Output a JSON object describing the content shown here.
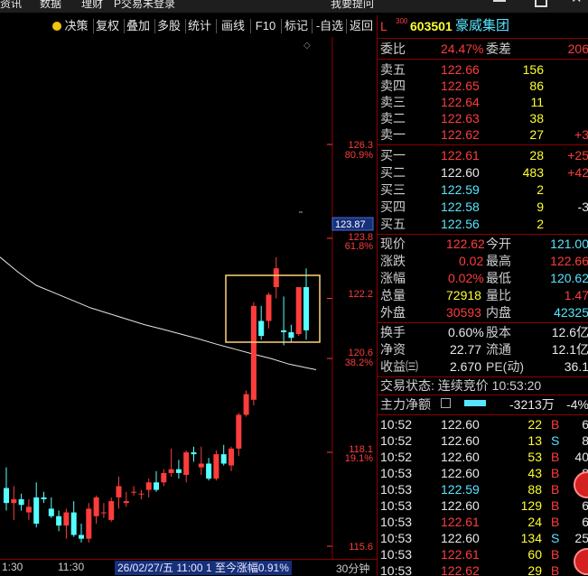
{
  "menubar": {
    "items": [
      "资讯",
      "数据",
      "理财",
      "P交易未登录"
    ],
    "right_label": "我要提问"
  },
  "toolbar": {
    "items": [
      "决策",
      "复权",
      "叠加",
      "多股",
      "统计",
      "画线",
      "F10",
      "标记",
      "-自选",
      "返回"
    ]
  },
  "chart": {
    "price_labels": [
      "126.3",
      "123.8",
      "122.2",
      "120.6",
      "118.1",
      "115.6"
    ],
    "pct_labels": [
      "80.9%",
      "61.8%",
      "38.2%",
      "19.1%"
    ],
    "current_price_tag": "123.87"
  },
  "chart_data": {
    "type": "candlestick",
    "period": "30分钟",
    "x_tick_labels": [
      "1:30",
      "11:30"
    ],
    "price_ticks": [
      126.3,
      123.8,
      122.2,
      120.6,
      118.1,
      115.6
    ],
    "fib_levels": [
      "80.9%",
      "61.8%",
      "38.2%",
      "19.1%"
    ],
    "ylim": [
      115.3,
      127.4
    ],
    "candles": [
      {
        "o": 117.15,
        "h": 117.7,
        "l": 116.55,
        "c": 116.75
      },
      {
        "o": 116.75,
        "h": 117.2,
        "l": 116.3,
        "c": 116.85
      },
      {
        "o": 116.85,
        "h": 117.0,
        "l": 116.55,
        "c": 116.7
      },
      {
        "o": 116.5,
        "h": 116.85,
        "l": 116.3,
        "c": 116.65
      },
      {
        "o": 116.9,
        "h": 117.3,
        "l": 116.1,
        "c": 116.2
      },
      {
        "o": 116.9,
        "h": 117.05,
        "l": 116.75,
        "c": 116.85
      },
      {
        "o": 116.6,
        "h": 116.9,
        "l": 116.35,
        "c": 116.4
      },
      {
        "o": 116.4,
        "h": 116.55,
        "l": 116.0,
        "c": 116.15
      },
      {
        "o": 116.15,
        "h": 116.6,
        "l": 115.8,
        "c": 116.5
      },
      {
        "o": 116.5,
        "h": 116.8,
        "l": 115.85,
        "c": 115.9
      },
      {
        "o": 115.9,
        "h": 116.2,
        "l": 115.7,
        "c": 115.8
      },
      {
        "o": 115.8,
        "h": 116.75,
        "l": 115.7,
        "c": 116.6
      },
      {
        "o": 116.4,
        "h": 116.95,
        "l": 116.2,
        "c": 116.9
      },
      {
        "o": 116.5,
        "h": 116.75,
        "l": 116.35,
        "c": 116.5
      },
      {
        "o": 116.3,
        "h": 116.9,
        "l": 116.25,
        "c": 116.8
      },
      {
        "o": 116.9,
        "h": 117.45,
        "l": 116.6,
        "c": 117.2
      },
      {
        "o": 116.75,
        "h": 117.05,
        "l": 116.65,
        "c": 116.8
      },
      {
        "o": 117.05,
        "h": 117.2,
        "l": 116.95,
        "c": 117.05
      },
      {
        "o": 117.0,
        "h": 117.1,
        "l": 116.85,
        "c": 117.0
      },
      {
        "o": 117.1,
        "h": 117.4,
        "l": 116.9,
        "c": 117.3
      },
      {
        "o": 117.3,
        "h": 117.6,
        "l": 117.05,
        "c": 117.1
      },
      {
        "o": 117.3,
        "h": 117.65,
        "l": 117.2,
        "c": 117.55
      },
      {
        "o": 117.55,
        "h": 118.2,
        "l": 117.45,
        "c": 117.65
      },
      {
        "o": 117.65,
        "h": 117.9,
        "l": 117.4,
        "c": 117.55
      },
      {
        "o": 117.5,
        "h": 118.15,
        "l": 117.3,
        "c": 118.1
      },
      {
        "o": 118.1,
        "h": 118.25,
        "l": 117.85,
        "c": 118.05
      },
      {
        "o": 117.7,
        "h": 118.25,
        "l": 117.5,
        "c": 117.8
      },
      {
        "o": 117.8,
        "h": 117.95,
        "l": 117.35,
        "c": 117.4
      },
      {
        "o": 117.4,
        "h": 118.15,
        "l": 117.35,
        "c": 118.05
      },
      {
        "o": 118.05,
        "h": 118.3,
        "l": 117.75,
        "c": 117.8
      },
      {
        "o": 117.75,
        "h": 118.25,
        "l": 117.6,
        "c": 118.2
      },
      {
        "o": 118.2,
        "h": 119.15,
        "l": 118.0,
        "c": 119.1
      },
      {
        "o": 119.1,
        "h": 119.75,
        "l": 119.05,
        "c": 119.65
      },
      {
        "o": 119.5,
        "h": 122.1,
        "l": 119.35,
        "c": 122.0
      },
      {
        "o": 121.6,
        "h": 122.0,
        "l": 121.1,
        "c": 121.2
      },
      {
        "o": 121.6,
        "h": 122.35,
        "l": 121.4,
        "c": 122.3
      },
      {
        "o": 122.5,
        "h": 123.3,
        "l": 122.2,
        "c": 123.0
      },
      {
        "o": 121.35,
        "h": 122.25,
        "l": 120.95,
        "c": 121.3
      },
      {
        "o": 121.3,
        "h": 121.5,
        "l": 121.05,
        "c": 121.15
      },
      {
        "o": 121.25,
        "h": 122.5,
        "l": 121.2,
        "c": 122.5
      },
      {
        "o": 122.5,
        "h": 123.0,
        "l": 121.1,
        "c": 121.35
      }
    ],
    "ma_line": [
      [
        0,
        123.3
      ],
      [
        20,
        122.9
      ],
      [
        40,
        122.55
      ],
      [
        60,
        122.35
      ],
      [
        80,
        122.15
      ],
      [
        100,
        121.95
      ],
      [
        120,
        121.8
      ],
      [
        140,
        121.65
      ],
      [
        160,
        121.5
      ],
      [
        180,
        121.38
      ],
      [
        200,
        121.25
      ],
      [
        220,
        121.12
      ],
      [
        240,
        120.98
      ],
      [
        260,
        120.85
      ],
      [
        280,
        120.72
      ],
      [
        300,
        120.6
      ],
      [
        320,
        120.45
      ],
      [
        340,
        120.35
      ],
      [
        350,
        120.3
      ]
    ]
  },
  "bottombar": {
    "time_left": "1:30",
    "time_mid": "11:30",
    "info": "26/02/27/五 11:00 1 至今涨幅0.91%",
    "period": "30分钟"
  },
  "stock": {
    "market": "L",
    "board": "300",
    "code": "603501",
    "name": "豪威集团"
  },
  "weibi": {
    "label": "委比",
    "value": "24.47%",
    "label2": "委差",
    "value2": "206"
  },
  "sell_orders": [
    {
      "label": "卖五",
      "price": "122.66",
      "vol": "156",
      "chg": ""
    },
    {
      "label": "卖四",
      "price": "122.65",
      "vol": "86",
      "chg": ""
    },
    {
      "label": "卖三",
      "price": "122.64",
      "vol": "11",
      "chg": ""
    },
    {
      "label": "卖二",
      "price": "122.63",
      "vol": "38",
      "chg": ""
    },
    {
      "label": "卖一",
      "price": "122.62",
      "vol": "27",
      "chg": "+3"
    }
  ],
  "buy_orders": [
    {
      "label": "买一",
      "price": "122.61",
      "vol": "28",
      "chg": "+25"
    },
    {
      "label": "买二",
      "price": "122.60",
      "vol": "483",
      "chg": "+42"
    },
    {
      "label": "买三",
      "price": "122.59",
      "vol": "2",
      "chg": ""
    },
    {
      "label": "买四",
      "price": "122.58",
      "vol": "9",
      "chg": "-3"
    },
    {
      "label": "买五",
      "price": "122.56",
      "vol": "2",
      "chg": ""
    }
  ],
  "quote": {
    "xianjia_label": "现价",
    "xianjia": "122.62",
    "jinkai_label": "今开",
    "jinkai": "121.00",
    "zhangdie_label": "涨跌",
    "zhangdie": "0.02",
    "zuigao_label": "最高",
    "zuigao": "122.66",
    "zhangfu_label": "涨幅",
    "zhangfu": "0.02%",
    "zuidi_label": "最低",
    "zuidi": "120.62",
    "zongliang_label": "总量",
    "zongliang": "72918",
    "liangbi_label": "量比",
    "liangbi": "1.47",
    "waipan_label": "外盘",
    "waipan": "30593",
    "neipan_label": "内盘",
    "neipan": "42325",
    "huanshou_label": "换手",
    "huanshou": "0.60%",
    "guben_label": "股本",
    "guben": "12.6亿",
    "jingzi_label": "净资",
    "jingzi": "22.77",
    "liutong_label": "流通",
    "liutong": "12.1亿",
    "shouyi_label": "收益㈢",
    "shouyi": "2.670",
    "pe_label": "PE(动)",
    "pe": "36.1"
  },
  "trade_status": "交易状态: 连续竞价 10:53:20",
  "netflow": {
    "label": "主力净额",
    "value": "-3213万",
    "pct": "-4%"
  },
  "ticks": [
    {
      "time": "10:52",
      "price": "122.60",
      "vol": "22",
      "side": "B",
      "n": "6"
    },
    {
      "time": "10:52",
      "price": "122.60",
      "vol": "13",
      "side": "S",
      "n": "8"
    },
    {
      "time": "10:52",
      "price": "122.60",
      "vol": "53",
      "side": "B",
      "n": "40"
    },
    {
      "time": "10:53",
      "price": "122.60",
      "vol": "43",
      "side": "B",
      "n": "8"
    },
    {
      "time": "10:53",
      "price": "122.59",
      "vol": "88",
      "side": "B",
      "n": "6"
    },
    {
      "time": "10:53",
      "price": "122.60",
      "vol": "129",
      "side": "B",
      "n": "6"
    },
    {
      "time": "10:53",
      "price": "122.61",
      "vol": "24",
      "side": "B",
      "n": "6"
    },
    {
      "time": "10:53",
      "price": "122.60",
      "vol": "134",
      "side": "S",
      "n": "25"
    },
    {
      "time": "10:53",
      "price": "122.61",
      "vol": "60",
      "side": "B",
      "n": "9"
    },
    {
      "time": "10:53",
      "price": "122.62",
      "vol": "29",
      "side": "B",
      "n": "6"
    }
  ],
  "colors": {
    "up": "#ff3c3c",
    "down": "#54ffff",
    "ma": "#e6e6e6",
    "box": "#ffd700",
    "flat": "#e8e8e8"
  }
}
